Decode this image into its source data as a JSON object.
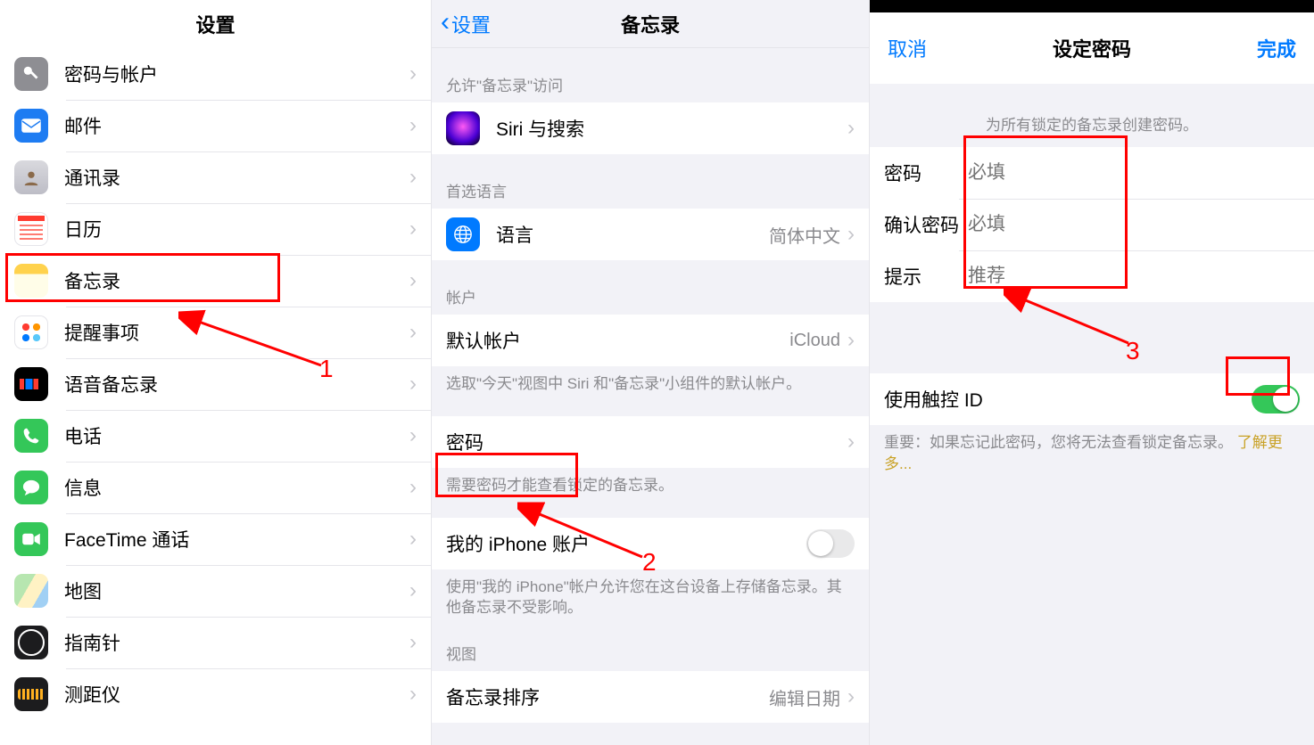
{
  "panel1": {
    "title": "设置",
    "items": [
      {
        "label": "密码与帐户"
      },
      {
        "label": "邮件"
      },
      {
        "label": "通讯录"
      },
      {
        "label": "日历"
      },
      {
        "label": "备忘录"
      },
      {
        "label": "提醒事项"
      },
      {
        "label": "语音备忘录"
      },
      {
        "label": "电话"
      },
      {
        "label": "信息"
      },
      {
        "label": "FaceTime 通话"
      },
      {
        "label": "地图"
      },
      {
        "label": "指南针"
      },
      {
        "label": "测距仪"
      }
    ]
  },
  "panel2": {
    "back": "设置",
    "title": "备忘录",
    "sections": {
      "access_header": "允许\"备忘录\"访问",
      "siri": "Siri 与搜索",
      "lang_header": "首选语言",
      "language_label": "语言",
      "language_value": "简体中文",
      "account_header": "帐户",
      "default_account_label": "默认帐户",
      "default_account_value": "iCloud",
      "default_account_footer": "选取\"今天\"视图中 Siri 和\"备忘录\"小组件的默认帐户。",
      "password_label": "密码",
      "password_footer": "需要密码才能查看锁定的备忘录。",
      "iphone_account_label": "我的 iPhone 账户",
      "iphone_account_footer": "使用\"我的 iPhone\"帐户允许您在这台设备上存储备忘录。其他备忘录不受影响。",
      "view_header": "视图",
      "sort_label": "备忘录排序",
      "sort_value": "编辑日期"
    }
  },
  "panel3": {
    "cancel": "取消",
    "title": "设定密码",
    "done": "完成",
    "hint": "为所有锁定的备忘录创建密码。",
    "fields": {
      "password_label": "密码",
      "password_placeholder": "必填",
      "confirm_label": "确认密码",
      "confirm_placeholder": "必填",
      "hint_label": "提示",
      "hint_placeholder": "推荐"
    },
    "touchid_label": "使用触控 ID",
    "touchid_on": true,
    "footer_prefix": "重要：如果忘记此密码，您将无法查看锁定备忘录。",
    "footer_link": "了解更多..."
  },
  "annotations": {
    "label1": "1",
    "label2": "2",
    "label3": "3"
  }
}
